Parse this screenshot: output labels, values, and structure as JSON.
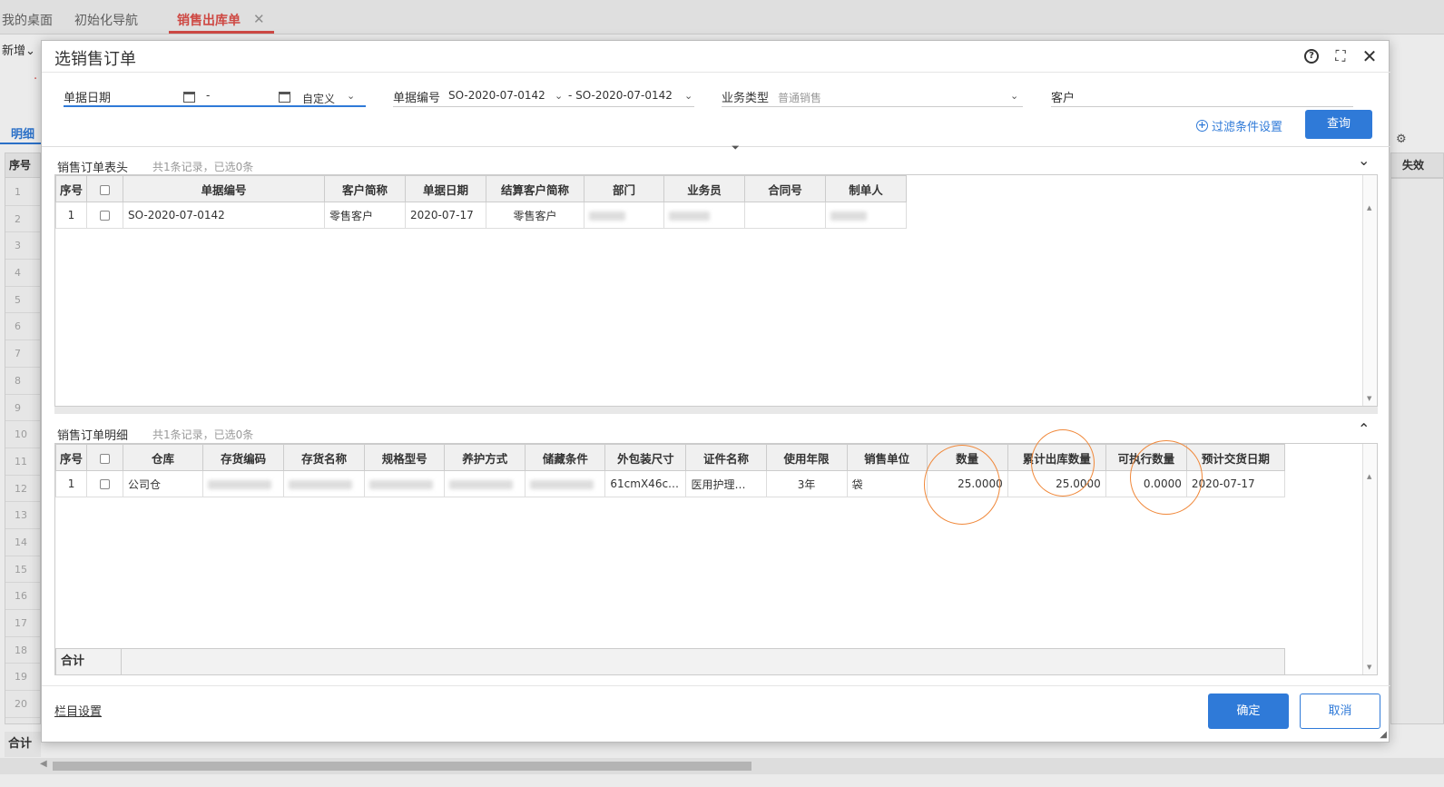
{
  "app": {
    "tabs": [
      "我的桌面",
      "初始化导航",
      "销售出库单"
    ],
    "new_label": "新增",
    "detail_tab": "明细",
    "seq_header": "序号",
    "right_header": "失效",
    "row_numbers": [
      "1",
      "2",
      "3",
      "4",
      "5",
      "6",
      "7",
      "8",
      "9",
      "10",
      "11",
      "12",
      "13",
      "14",
      "15",
      "16",
      "17",
      "18",
      "19",
      "20"
    ],
    "total_label": "合计"
  },
  "modal": {
    "title": "选销售订单",
    "filters": {
      "date_label": "单据日期",
      "date_sep": "-",
      "date_mode": "自定义",
      "code_label": "单据编号",
      "code_from": "SO-2020-07-0142",
      "code_to": "- SO-2020-07-0142",
      "biz_label": "业务类型",
      "biz_placeholder": "普通销售",
      "customer_label": "客户",
      "filter_settings": "过滤条件设置",
      "query_button": "查询"
    },
    "header_section": {
      "title": "销售订单表头",
      "count": "共1条记录，已选0条",
      "columns": [
        "序号",
        "",
        "单据编号",
        "客户简称",
        "单据日期",
        "结算客户简称",
        "部门",
        "业务员",
        "合同号",
        "制单人"
      ],
      "rows": [
        {
          "seq": "1",
          "code": "SO-2020-07-0142",
          "customer": "零售客户",
          "date": "2020-07-17",
          "settle_customer": "零售客户"
        }
      ]
    },
    "detail_section": {
      "title": "销售订单明细",
      "count": "共1条记录，已选0条",
      "columns": [
        "序号",
        "",
        "仓库",
        "存货编码",
        "存货名称",
        "规格型号",
        "养护方式",
        "储藏条件",
        "外包装尺寸",
        "证件名称",
        "使用年限",
        "销售单位",
        "数量",
        "累计出库数量",
        "可执行数量",
        "预计交货日期"
      ],
      "rows": [
        {
          "seq": "1",
          "warehouse": "公司仓",
          "package_size": "61cmX46c…",
          "cert_name": "医用护理…",
          "years": "3年",
          "unit": "袋",
          "qty": "25.0000",
          "out_qty": "25.0000",
          "exec_qty": "0.0000",
          "delivery_date": "2020-07-17"
        }
      ],
      "total_label": "合计"
    },
    "column_settings": "栏目设置",
    "ok_button": "确定",
    "cancel_button": "取消"
  }
}
